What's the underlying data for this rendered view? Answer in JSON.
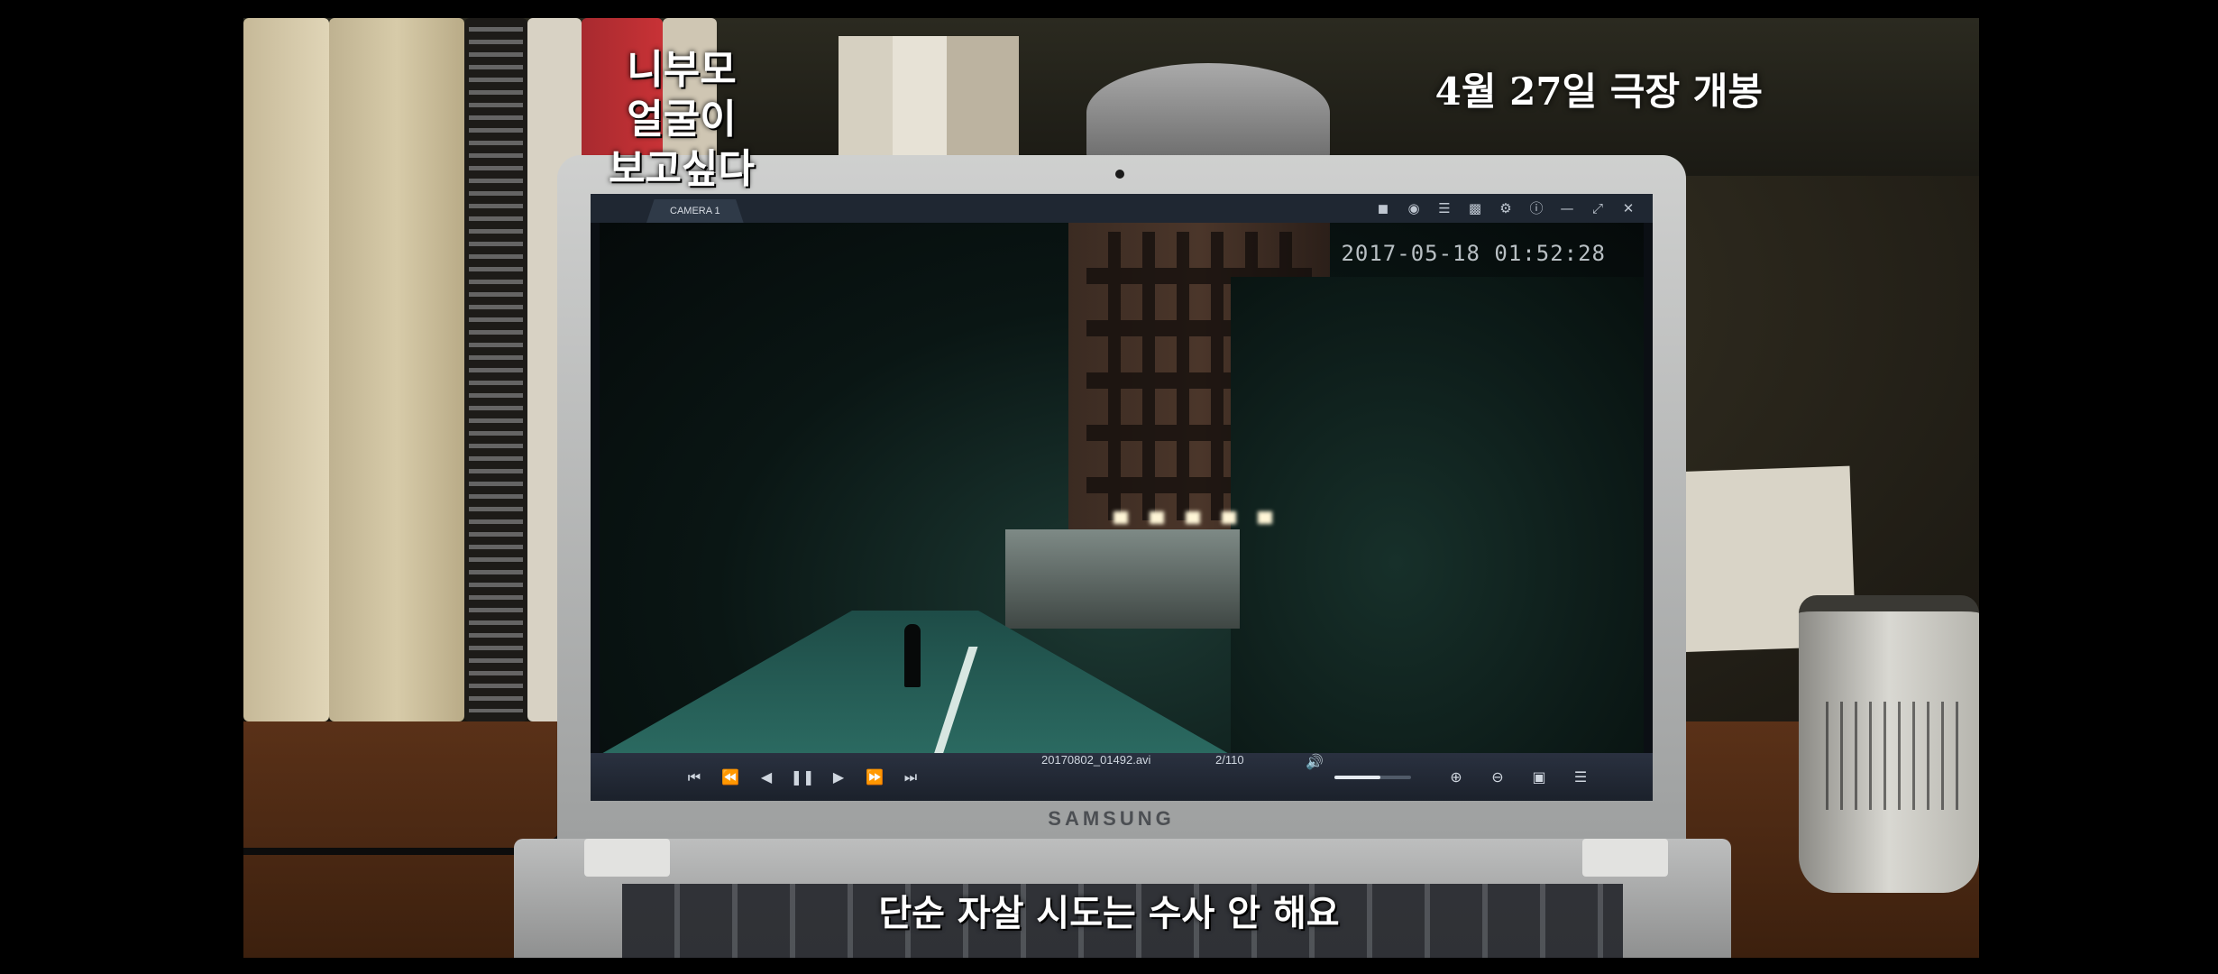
{
  "overlay": {
    "film_title_lines": [
      "니부모",
      "얼굴이",
      "보고싶다"
    ],
    "release_text": "4월 27일 극장 개봉",
    "subtitle": "단순 자살 시도는 수사 안 해요"
  },
  "laptop": {
    "brand": "SAMSUNG"
  },
  "player": {
    "tab_label": "CAMERA 1",
    "timestamp": "2017-05-18  01:52:28",
    "filename": "20170802_01492.avi",
    "counter": "2/110",
    "volume_level_percent": 60,
    "window_icons": [
      "camera-icon",
      "pin-icon",
      "list-icon",
      "printer-icon",
      "gear-icon",
      "info-icon",
      "minimize-icon",
      "maximize-icon",
      "close-icon"
    ],
    "playback_icons": [
      "skip-start-icon",
      "rewind-icon",
      "step-back-icon",
      "pause-icon",
      "play-icon",
      "fast-forward-icon",
      "skip-end-icon"
    ],
    "tool_icons": [
      "zoom-in-icon",
      "zoom-out-icon",
      "save-icon",
      "menu-icon"
    ]
  }
}
